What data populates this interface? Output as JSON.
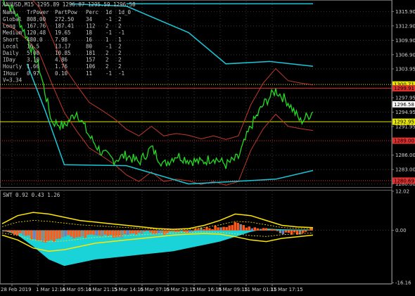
{
  "window": {
    "title": "XAUUSD,M15  1295.89 1296.87 1295.59 1296.58"
  },
  "colors": {
    "background": "#000000",
    "grid": "#3a3a3a",
    "price": "#22dd22",
    "channel_red": "#c0392b",
    "channel_cyan": "#18c8d8",
    "hline_yellow": "#e8e800",
    "hline_red": "#e03030",
    "osc_cyan": "#19d3d8",
    "osc_orange": "#ff5a1a",
    "osc_yellow": "#ffe600",
    "osc_grey": "#8a8a8a",
    "osc_blue": "#6a7fc8"
  },
  "stats_table": {
    "headers": [
      "Name",
      "TrPower",
      "PartPow",
      "Perc",
      "1d",
      "1d_0"
    ],
    "rows": [
      [
        "Global",
        "808.00",
        "272.50",
        "34",
        "-1",
        "2"
      ],
      [
        "Long",
        "167.76",
        "187.41",
        "112",
        "2",
        "2"
      ],
      [
        "Medium",
        "120.48",
        "19.65",
        "18",
        "-1",
        "-1"
      ],
      [
        "Short",
        "480.0",
        "7.98",
        "16",
        "1",
        "1"
      ],
      [
        "Local",
        "16.5",
        "13.17",
        "80",
        "-1",
        "2"
      ],
      [
        "Daily",
        "5.00",
        "10.85",
        "181",
        "2",
        "2"
      ],
      [
        "IDay",
        "3.10",
        "4.86",
        "157",
        "2",
        "2"
      ],
      [
        "Hourly",
        "1.66",
        "1.76",
        "106",
        "2",
        "2"
      ],
      [
        "IHour",
        "0.97",
        "0.10",
        "11",
        "-1",
        "-1"
      ]
    ],
    "footer": "V=3.34"
  },
  "oscillator": {
    "title": "SWT 0.92 0.43 1.26"
  },
  "chart_data": [
    {
      "type": "line",
      "title": "XAUUSD,M15",
      "x_tick_labels": [
        "28 Feb 2019",
        "1 Mar 12:15",
        "4 Mar 05:15",
        "4 Mar 21:15",
        "5 Mar 14:15",
        "6 Mar 07:15",
        "6 Mar 23:15",
        "7 Mar 16:15",
        "8 Mar 09:15",
        "11 Mar 01:15",
        "11 Mar 17:15"
      ],
      "y_tick_labels": [
        "1315.90",
        "1312.90",
        "1309.90",
        "1306.90",
        "1303.95",
        "1297.95",
        "1294.95",
        "1291.95",
        "1286.00",
        "1283.00",
        "1280.00"
      ],
      "ylim": [
        1279.5,
        1318.0
      ],
      "price_tags": [
        {
          "value": 1300.71,
          "label": "1300.71",
          "color": "#e8e800"
        },
        {
          "value": 1299.91,
          "label": "1299.91",
          "color": "#e03030"
        },
        {
          "value": 1296.58,
          "label": "1296.58",
          "color": "#ffffff"
        },
        {
          "value": 1292.95,
          "label": "1292.95",
          "color": "#e8e800"
        },
        {
          "value": 1289.0,
          "label": "1289.00",
          "color": "#e03030"
        },
        {
          "value": 1280.69,
          "label": "1280.69",
          "color": "#e03030"
        }
      ],
      "horizontal_lines": [
        {
          "value": 1300.71,
          "style": "dotted",
          "color": "#e8e800"
        },
        {
          "value": 1299.91,
          "style": "solid",
          "color": "#e03030"
        },
        {
          "value": 1292.95,
          "style": "solid",
          "color": "#e8e800"
        },
        {
          "value": 1289.0,
          "style": "dotted",
          "color": "#e03030"
        },
        {
          "value": 1280.69,
          "style": "dotted",
          "color": "#e03030"
        }
      ],
      "x": [
        0,
        4,
        8,
        12,
        16,
        20,
        24,
        28,
        32,
        36,
        40,
        44,
        48,
        52,
        56,
        60,
        64,
        68,
        72,
        76,
        80,
        84,
        88,
        92,
        96,
        100
      ],
      "series": [
        {
          "values": [
            1318.5,
            1316.0,
            1310.5,
            1304.0,
            1293.0,
            1292.0,
            1295.0,
            1290.0,
            1286.5,
            1285.0,
            1286.0,
            1284.5,
            1287.5,
            1284.0,
            1286.0,
            1285.0,
            1284.5,
            1285.5,
            1284.0,
            1285.5,
            1292.0,
            1296.5,
            1299.5,
            1297.0,
            1293.0,
            1295.0
          ]
        }
      ]
    },
    {
      "type": "area",
      "title": "SWT 0.92 0.43 1.26",
      "y_tick_labels": [
        "12.02",
        "0.00",
        "-16.16"
      ],
      "ylim": [
        -16.16,
        12.02
      ],
      "x": [
        0,
        5,
        10,
        15,
        20,
        25,
        30,
        35,
        40,
        45,
        50,
        55,
        60,
        65,
        70,
        75,
        80,
        85,
        90,
        95,
        100
      ],
      "series": [
        {
          "values": [
            0,
            -1.5,
            -5.0,
            -9.0,
            -11.0,
            -10.0,
            -9.0,
            -8.5,
            -8.0,
            -7.5,
            -7.0,
            -6.5,
            -5.5,
            -4.5,
            -3.5,
            -2.0,
            -0.5,
            0.5,
            0.3,
            0.2,
            0.2
          ]
        },
        {
          "values": [
            0,
            -1.0,
            -2.5,
            -3.5,
            -1.5,
            -2.5,
            -1.0,
            -2.0,
            -1.5,
            -0.5,
            -1.0,
            -0.5,
            -0.2,
            0.5,
            1.2,
            2.0,
            1.0,
            0.5,
            -0.5,
            -0.8,
            0.3
          ]
        },
        {
          "values": [
            2.0,
            4.5,
            5.5,
            5.0,
            4.0,
            3.0,
            2.5,
            2.0,
            1.5,
            1.0,
            0.5,
            0.3,
            0.5,
            1.5,
            3.0,
            5.0,
            4.5,
            3.0,
            1.5,
            1.0,
            0.8
          ]
        },
        {
          "values": [
            -1.5,
            -3.0,
            -5.5,
            -6.5,
            -6.0,
            -5.0,
            -4.0,
            -3.5,
            -3.0,
            -2.5,
            -2.0,
            -1.5,
            -1.2,
            -1.0,
            -1.2,
            -2.0,
            -3.0,
            -3.5,
            -2.5,
            -2.0,
            -1.5
          ]
        }
      ]
    }
  ]
}
